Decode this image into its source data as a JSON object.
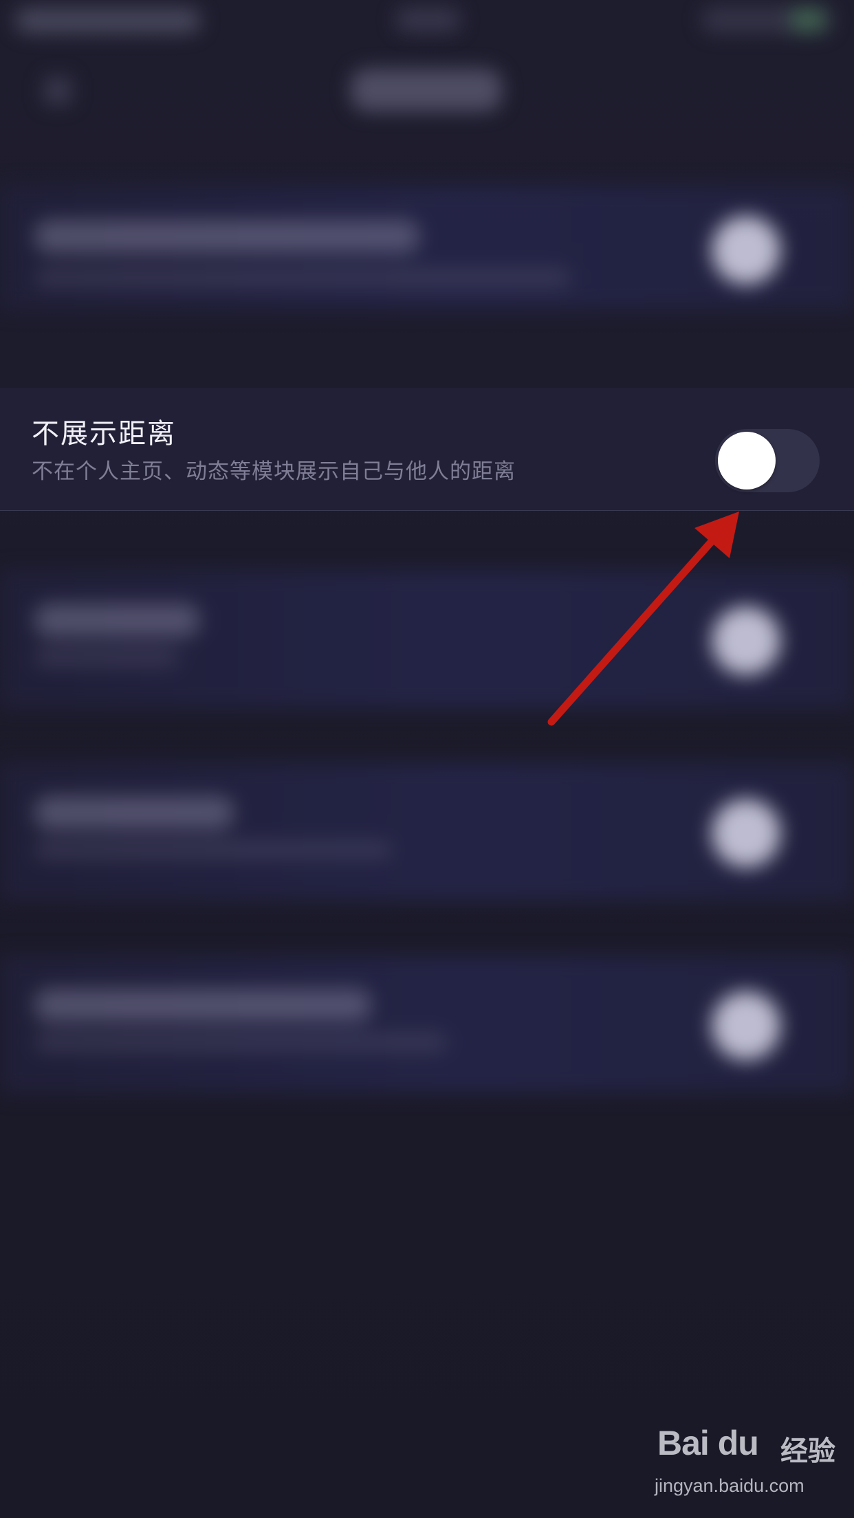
{
  "setting": {
    "title": "不展示距离",
    "description": "不在个人主页、动态等模块展示自己与他人的距离",
    "toggle_state": "off"
  },
  "watermark": {
    "logo": "Bai du",
    "brand": "经验",
    "url": "jingyan.baidu.com"
  },
  "colors": {
    "background": "#1b1a29",
    "row_background": "#212036",
    "toggle_track": "#33324b",
    "toggle_knob": "#ffffff",
    "annotation_arrow": "#c41a14"
  }
}
